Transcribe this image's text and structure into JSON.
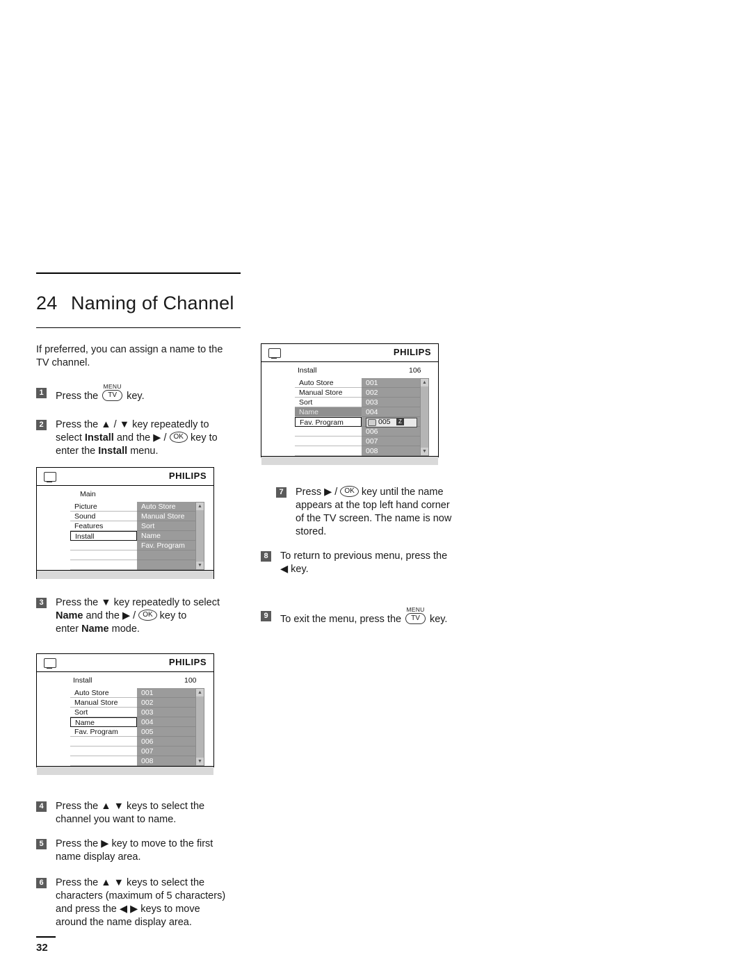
{
  "page": {
    "section_number": "24",
    "section_title": "Naming of Channel",
    "page_number": "32"
  },
  "intro": "If preferred, you can assign a name to the TV channel.",
  "steps": [
    {
      "num": "1",
      "parts": [
        "Press the",
        "key."
      ],
      "key": "TV",
      "key_top": "MENU"
    },
    {
      "num": "2",
      "text_1": "Press the ▲ / ▼ key repeatedly to",
      "text_2a": "select",
      "bold_1": "Install",
      "text_2b": "and the ▶ /",
      "ok": "OK",
      "text_2c": "key to",
      "text_3a": "enter the",
      "bold_2": "Install",
      "text_3b": "menu."
    },
    {
      "num": "3",
      "text_1": "Press the ▼ key repeatedly to select",
      "bold_1": "Name",
      "text_2a": "and the ▶ /",
      "ok": "OK",
      "text_2b": "key to",
      "text_3a": "enter",
      "bold_2": "Name",
      "text_3b": "mode."
    },
    {
      "num": "4",
      "text_1": "Press the ▲ ▼ keys to select the",
      "text_2": "channel you want to name."
    },
    {
      "num": "5",
      "text_1": "Press the ▶ key to move to the first",
      "text_2": "name display area."
    },
    {
      "num": "6",
      "text_1": "Press the ▲ ▼ keys to select the",
      "text_2": "characters (maximum of 5 characters)",
      "text_3": "and press the ◀  ▶ keys to move",
      "text_4": "around the name display area."
    },
    {
      "num": "7",
      "text_1a": "Press  ▶ /",
      "ok": "OK",
      "text_1b": "key until the name",
      "text_2": "appears at the top left hand corner",
      "text_3": "of the TV screen. The name is now",
      "text_4": "stored."
    },
    {
      "num": "8",
      "text_1": "To return to previous menu, press the",
      "text_2": "◀ key."
    },
    {
      "num": "9",
      "text_1": "To exit the menu, press the",
      "key": "TV",
      "key_top": "MENU",
      "text_2": "key."
    }
  ],
  "tv_main": {
    "brand": "PHILIPS",
    "header_label": "Main",
    "left_items": [
      "Picture",
      "Sound",
      "Features",
      "Install"
    ],
    "selected_left": "Install",
    "right_items": [
      "Auto Store",
      "Manual Store",
      "Sort",
      "Name",
      "Fav. Program"
    ],
    "scroll_up": "▲",
    "scroll_down": "▼"
  },
  "tv_install": {
    "brand": "PHILIPS",
    "header_label": "Install",
    "header_value": "100",
    "left_items": [
      "Auto Store",
      "Manual Store",
      "Sort",
      "Name",
      "Fav. Program"
    ],
    "selected_left": "Name",
    "right_items": [
      "001",
      "002",
      "003",
      "004",
      "005",
      "006",
      "007",
      "008"
    ],
    "scroll_up": "▲",
    "scroll_down": "▼"
  },
  "tv_name": {
    "brand": "PHILIPS",
    "header_label": "Install",
    "header_value": "106",
    "left_items": [
      "Auto Store",
      "Manual Store",
      "Sort",
      "Name",
      "Fav. Program"
    ],
    "selected_left": "Name",
    "right_items": [
      "001",
      "002",
      "003",
      "004",
      "005",
      "006",
      "007",
      "008"
    ],
    "edit_row_value": "005",
    "edit_row_char": "Z",
    "scroll_up": "▲",
    "scroll_down": "▼"
  }
}
